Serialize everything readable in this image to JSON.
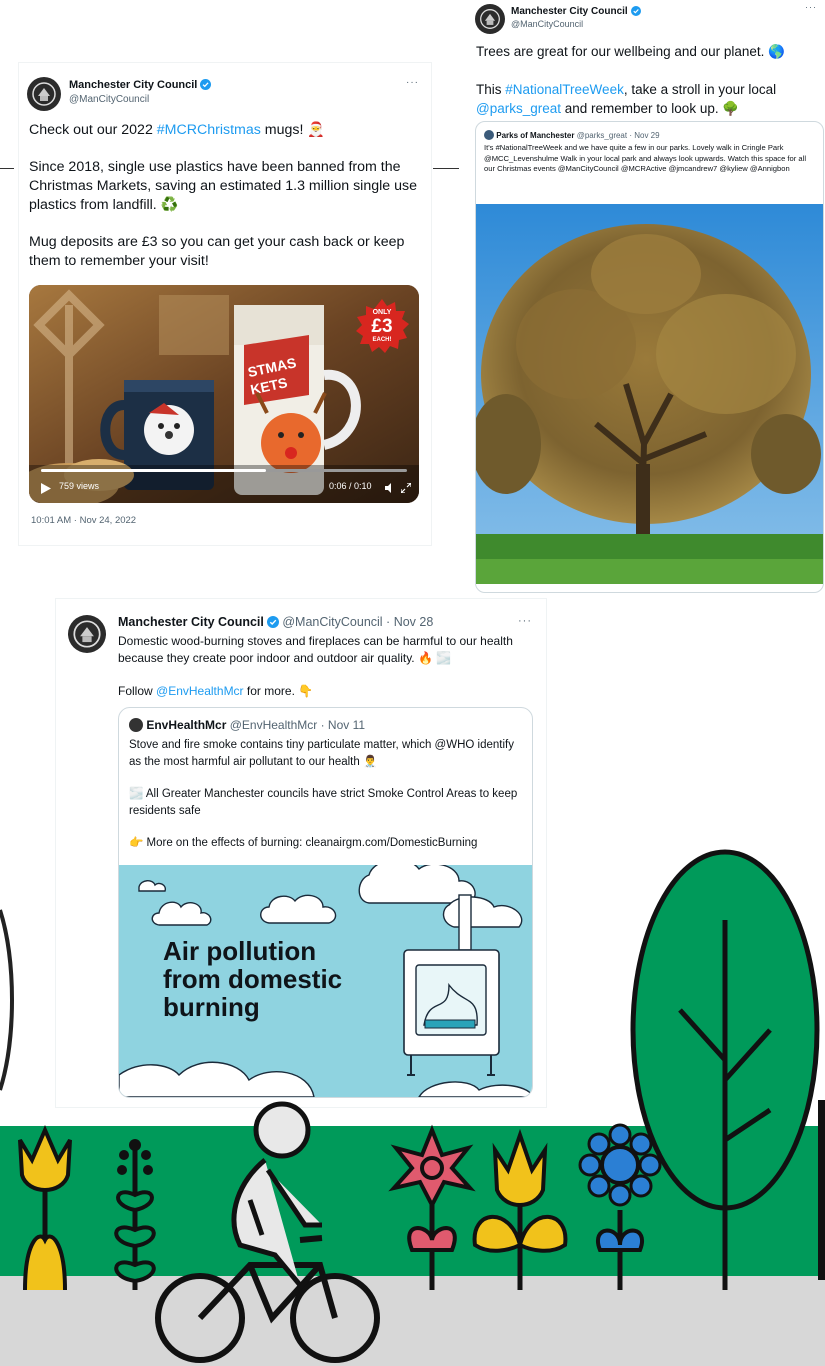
{
  "tweet1": {
    "name": "Manchester City Council",
    "handle": "@ManCityCouncil",
    "more": "···",
    "line1_pre": "Check out our 2022 ",
    "line1_tag": "#MCRChristmas",
    "line1_post": " mugs!",
    "para2": "Since 2018, single use plastics have been banned from the Christmas Markets, saving an estimated 1.3 million single use plastics from landfill.",
    "para3": "Mug deposits are £3 so you can get your cash back or keep them to remember your visit!",
    "badge_top": "ONLY",
    "badge_price": "£3",
    "badge_bottom": "EACH!",
    "mug_text": "STMAS KETS",
    "views": "759 views",
    "duration": "0:06 / 0:10",
    "timestamp": "10:01 AM · Nov 24, 2022"
  },
  "tweet2": {
    "name": "Manchester City Council",
    "handle": "@ManCityCouncil",
    "more": "···",
    "line1": "Trees are great for our wellbeing and our planet.",
    "line2_pre": "This ",
    "line2_tag": "#NationalTreeWeek",
    "line2_mid": ", take a stroll in your local ",
    "line2_mention": "@parks_great",
    "line2_post": " and remember to look up.",
    "quote": {
      "name": "Parks of Manchester",
      "handle": "@parks_great · Nov 29",
      "text": "It's #NationalTreeWeek and we have quite a few in our parks. Lovely walk in Cringle Park @MCC_Levenshulme Walk in your local park and always look upwards. Watch this space for all our Christmas events @ManCityCouncil @MCRActive @jmcandrew7 @kyliew @Annigbon"
    }
  },
  "tweet3": {
    "name": "Manchester City Council",
    "handle_date": "@ManCityCouncil · Nov 28",
    "more": "···",
    "text": "Domestic wood-burning stoves and fireplaces can be harmful to our health because they create poor indoor and outdoor air quality.",
    "follow_pre": "Follow ",
    "follow_mention": "@EnvHealthMcr",
    "follow_post": " for more.",
    "quote": {
      "name": "EnvHealthMcr",
      "handle_date": "@EnvHealthMcr · Nov 11",
      "p1": "Stove and fire smoke contains tiny particulate matter, which @WHO identify as the most harmful air pollutant to our health",
      "p2": "All Greater Manchester councils have strict Smoke Control Areas to keep residents safe",
      "p3": "More on the effects of burning: cleanairgm.com/DomesticBurning"
    },
    "image_line1": "Air pollution",
    "image_line2": "from domestic",
    "image_line3": "burning"
  },
  "colors": {
    "link": "#1d9bf0",
    "green_band": "#009a5a",
    "road": "#d7d7d7",
    "sky": "#8fd3e0"
  }
}
